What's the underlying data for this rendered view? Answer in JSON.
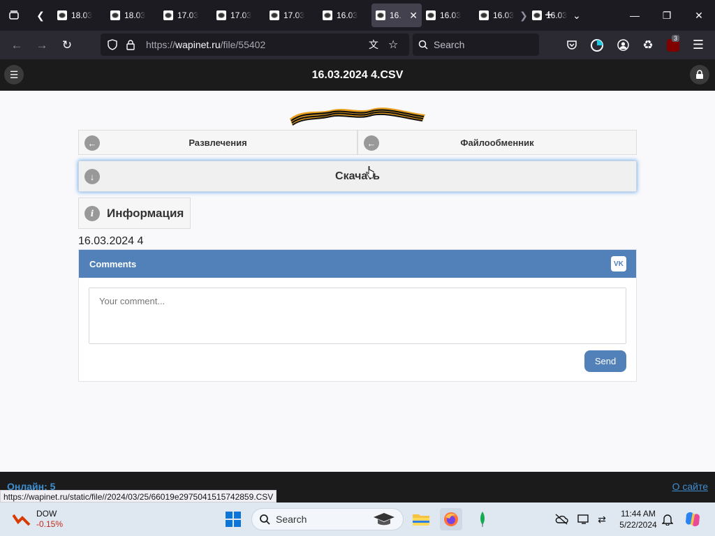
{
  "browser": {
    "tabs": [
      {
        "label": "18.03.",
        "active": false
      },
      {
        "label": "18.03.",
        "active": false
      },
      {
        "label": "17.03.",
        "active": false
      },
      {
        "label": "17.03.",
        "active": false
      },
      {
        "label": "17.03.",
        "active": false
      },
      {
        "label": "16.03.",
        "active": false
      },
      {
        "label": "16.",
        "active": true
      },
      {
        "label": "16.03.",
        "active": false
      },
      {
        "label": "16.03.",
        "active": false
      },
      {
        "label": "16.03.",
        "active": false
      }
    ],
    "url": {
      "scheme": "https://",
      "host": "wapinet.ru",
      "path": "/file/55402"
    },
    "search_placeholder": "Search",
    "extension_badge": "3",
    "status_url": "https://wapinet.ru/static/file//2024/03/25/66019e2975041515742859.CSV"
  },
  "site": {
    "title": "16.03.2024 4.CSV",
    "nav": {
      "left_label": "Развлечения",
      "right_label": "Файлообменник"
    },
    "download_label": "Скачать",
    "info_label": "Информация",
    "file_description": "16.03.2024 4",
    "comments": {
      "header": "Comments",
      "vk_logo": "VK",
      "placeholder": "Your comment...",
      "send_label": "Send"
    },
    "footer": {
      "online": "Онлайн: 5",
      "about": "О сайте"
    }
  },
  "taskbar": {
    "stock_name": "DOW",
    "stock_change": "-0.15%",
    "search_label": "Search",
    "time": "11:44 AM",
    "date": "5/22/2024"
  },
  "colors": {
    "vk_blue": "#5181b8",
    "site_header": "#1b1b1b",
    "link_blue": "#3d8fd1",
    "stock_negative": "#c42b1c"
  }
}
